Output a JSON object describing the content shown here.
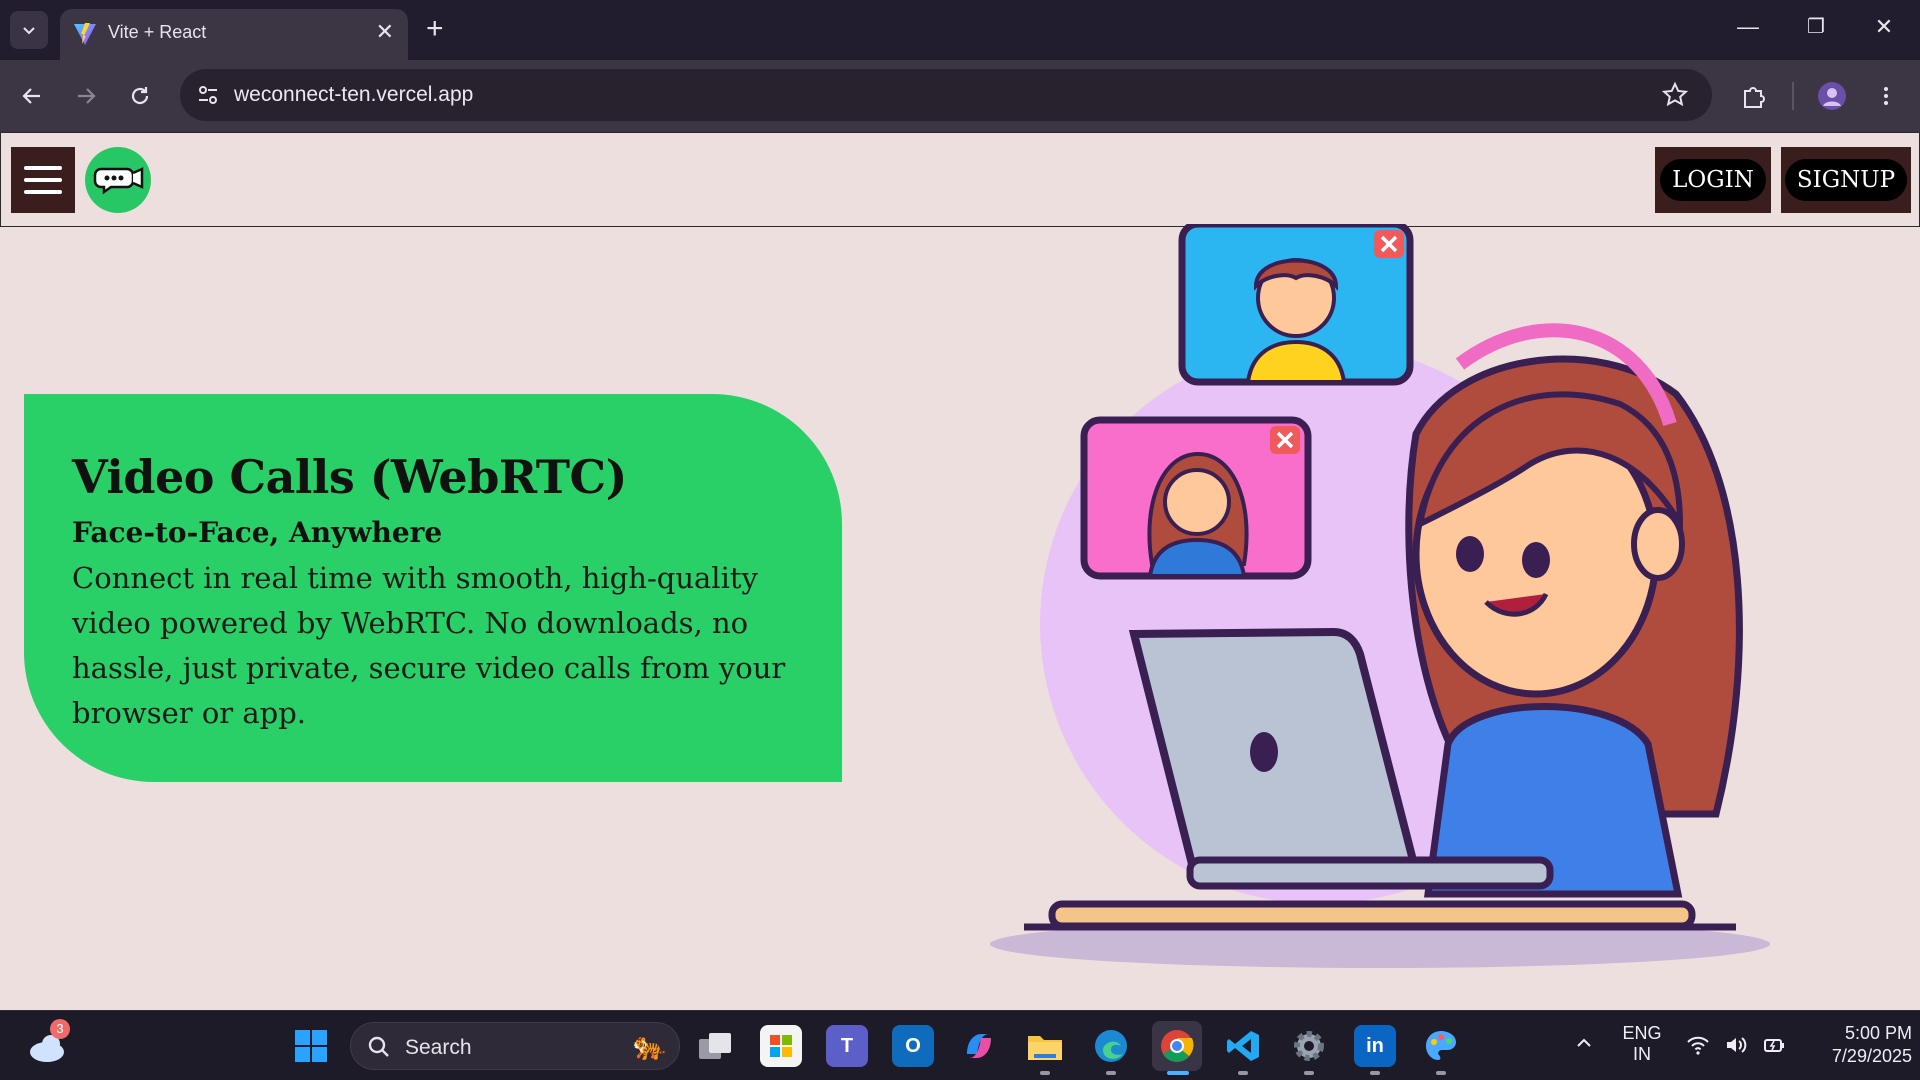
{
  "browser": {
    "tab_title": "Vite + React",
    "url": "weconnect-ten.vercel.app"
  },
  "header": {
    "login_label": "LOGIN",
    "signup_label": "SIGNUP"
  },
  "hero": {
    "title": "Video Calls (WebRTC)",
    "subtitle": "Face-to-Face, Anywhere",
    "description": "Connect in real time with smooth, high-quality video powered by WebRTC. No downloads, no hassle, just private, secure video calls from your browser or app."
  },
  "colors": {
    "hero_card": "#28d067",
    "page_bg": "#eddfdd",
    "header_button_bg": "#3a1d1d"
  },
  "taskbar": {
    "weather_badge": "3",
    "search_placeholder": "Search",
    "language_line1": "ENG",
    "language_line2": "IN",
    "time": "5:00 PM",
    "date": "7/29/2025",
    "apps": [
      "task-view",
      "microsoft-store",
      "teams",
      "outlook",
      "copilot",
      "file-explorer",
      "edge",
      "chrome",
      "vscode",
      "settings",
      "linkedin",
      "paint"
    ]
  }
}
